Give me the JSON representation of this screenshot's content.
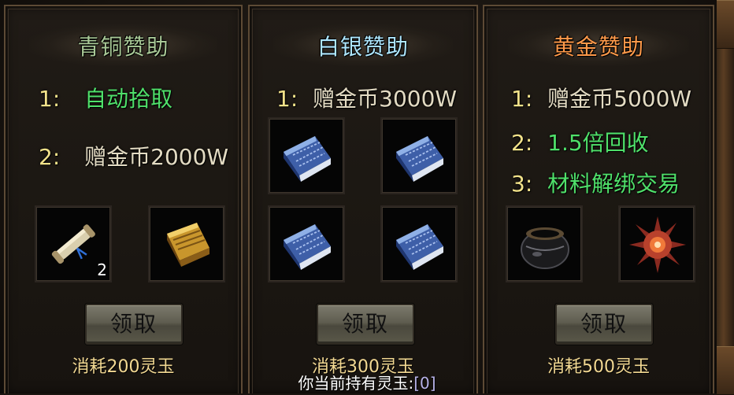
{
  "panels": {
    "bronze": {
      "title": "青铜赞助",
      "benefits": [
        {
          "num": "1:",
          "text": "自动拾取"
        },
        {
          "num": "2:",
          "text": "赠金币2000W"
        }
      ],
      "items": [
        {
          "icon": "scroll-icon",
          "count": "2"
        },
        {
          "icon": "golden-book-icon",
          "count": ""
        }
      ],
      "button_label": "领取",
      "cost": "消耗200灵玉"
    },
    "silver": {
      "title": "白银赞助",
      "benefits": [
        {
          "num": "1:",
          "text": "赠金币3000W"
        }
      ],
      "items": [
        {
          "icon": "blue-book-icon",
          "count": ""
        },
        {
          "icon": "blue-book-icon",
          "count": ""
        },
        {
          "icon": "blue-book-icon",
          "count": ""
        },
        {
          "icon": "blue-book-icon",
          "count": ""
        }
      ],
      "button_label": "领取",
      "cost": "消耗300灵玉"
    },
    "gold": {
      "title": "黄金赞助",
      "benefits": [
        {
          "num": "1:",
          "text": "赠金币5000W"
        },
        {
          "num": "2:",
          "text": "1.5倍回收"
        },
        {
          "num": "3:",
          "text": "材料解绑交易"
        }
      ],
      "items": [
        {
          "icon": "black-pot-icon",
          "count": ""
        },
        {
          "icon": "spiked-orb-icon",
          "count": ""
        }
      ],
      "button_label": "领取",
      "cost": "消耗500灵玉"
    }
  },
  "footer": {
    "label": "你当前持有灵玉:",
    "value": "[0]"
  },
  "colors": {
    "bronze_title": "#a9c997",
    "silver_title": "#aee7ff",
    "gold_title": "#ff9a4a",
    "number": "#f2e28a",
    "benefit_green": "#4fe06a",
    "benefit_beige": "#e3dbc3",
    "cost": "#f2d892"
  }
}
